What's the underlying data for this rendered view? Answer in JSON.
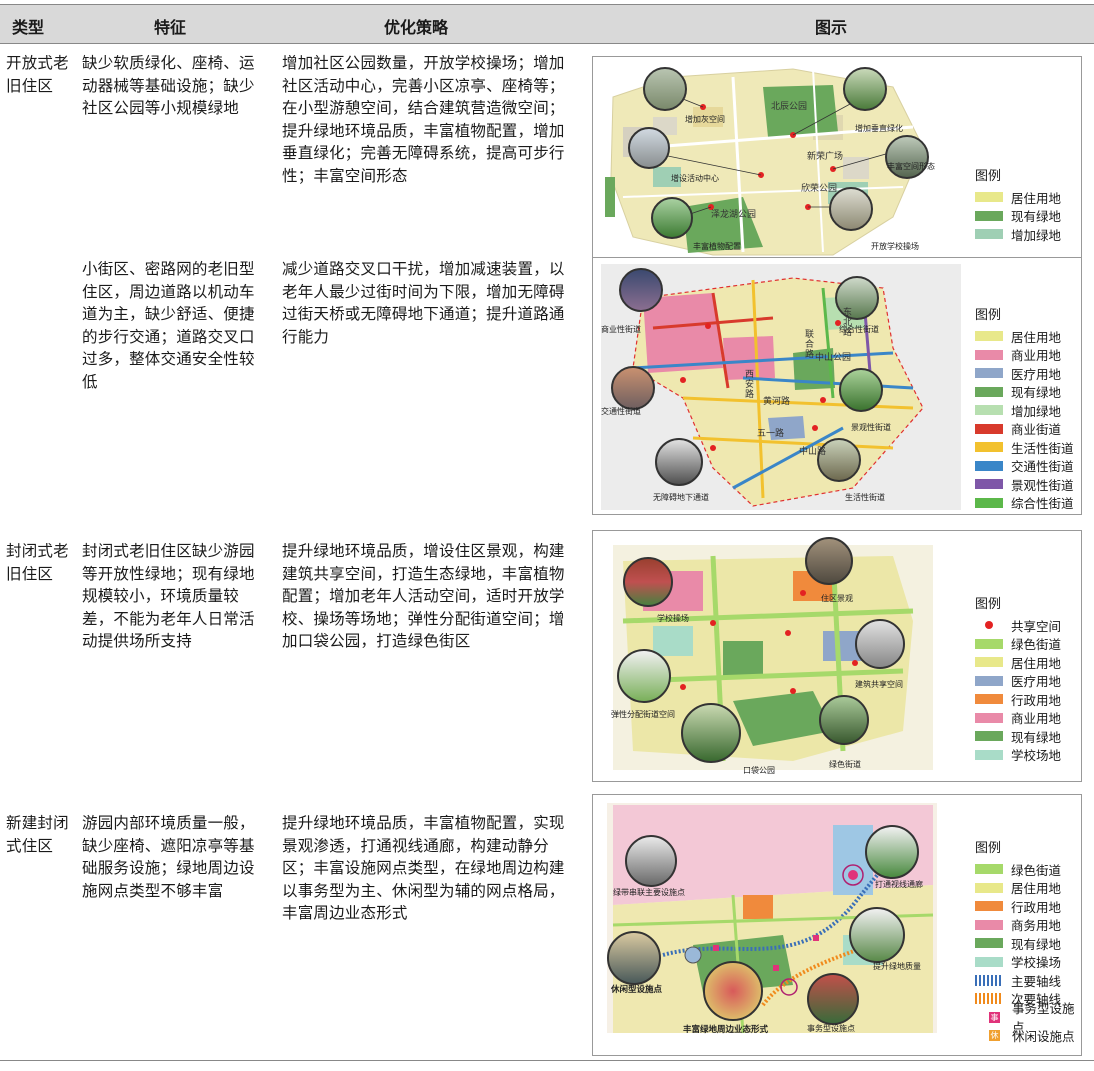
{
  "header": {
    "type": "类型",
    "feature": "特征",
    "strategy": "优化策略",
    "figure": "图示"
  },
  "rows": [
    {
      "type": "开放式老旧住区",
      "feature": "缺少软质绿化、座椅、运动器械等基础设施；缺少社区公园等小规模绿地",
      "strategy": "增加社区公园数量，开放学校操场；增加社区活动中心，完善小区凉亭、座椅等；在小型游憩空间，结合建筑营造微空间；提升绿地环境品质，丰富植物配置，增加垂直绿化；完善无障碍系统，提高可步行性；丰富空间形态",
      "figure": {
        "places": [
          "北辰公园",
          "新荣广场",
          "欣荣公园",
          "泽龙湖公园"
        ],
        "callouts": [
          "增加灰空间",
          "增加垂直绿化",
          "增设活动中心",
          "丰富空间形态",
          "丰富植物配置",
          "开放学校操场"
        ],
        "legend_title": "图例",
        "legend": [
          {
            "label": "居住用地",
            "color": "#e8e88a"
          },
          {
            "label": "现有绿地",
            "color": "#6aa85c"
          },
          {
            "label": "增加绿地",
            "color": "#9fcfb4"
          }
        ]
      }
    },
    {
      "type": "",
      "feature": "小街区、密路网的老旧型住区，周边道路以机动车道为主，缺少舒适、便捷的步行交通；道路交叉口过多，整体交通安全性较低",
      "strategy": "减少道路交叉口干扰，增加减速装置，以老年人最少过街时间为下限，增加无障碍过街天桥或无障碍地下通道；提升道路通行能力",
      "figure": {
        "places": [
          "联合路",
          "东北路",
          "中山公园",
          "黄河路",
          "西安路",
          "五一路",
          "中山路"
        ],
        "callouts": [
          "商业性街道",
          "综合性街道",
          "交通性街道",
          "景观性街道",
          "无障碍地下通道",
          "生活性街道"
        ],
        "legend_title": "图例",
        "legend": [
          {
            "label": "居住用地",
            "color": "#e8e88a"
          },
          {
            "label": "商业用地",
            "color": "#e98aa8"
          },
          {
            "label": "医疗用地",
            "color": "#8fa6c9"
          },
          {
            "label": "现有绿地",
            "color": "#6aa85c"
          },
          {
            "label": "增加绿地",
            "color": "#b7dfb0"
          },
          {
            "label": "商业街道",
            "color": "#d83a2c"
          },
          {
            "label": "生活性街道",
            "color": "#f2c12e"
          },
          {
            "label": "交通性街道",
            "color": "#3a86c8"
          },
          {
            "label": "景观性街道",
            "color": "#7e57a8"
          },
          {
            "label": "综合性街道",
            "color": "#5cb84a"
          }
        ]
      }
    },
    {
      "type": "封闭式老旧住区",
      "feature": "封闭式老旧住区缺少游园等开放性绿地；现有绿地规模较小，环境质量较差，不能为老年人日常活动提供场所支持",
      "strategy": "提升绿地环境品质，增设住区景观，构建建筑共享空间，打造生态绿地，丰富植物配置；增加老年人活动空间，适时开放学校、操场等场地；弹性分配街道空间；增加口袋公园，打造绿色街区",
      "figure": {
        "callouts": [
          "学校操场",
          "住区景观",
          "建筑共享空间",
          "弹性分配街道空间",
          "口袋公园",
          "绿色街道"
        ],
        "legend_title": "图例",
        "legend": [
          {
            "label": "共享空间",
            "kind": "dot"
          },
          {
            "label": "绿色街道",
            "color": "#a6d96a"
          },
          {
            "label": "居住用地",
            "color": "#e8e88a"
          },
          {
            "label": "医疗用地",
            "color": "#8fa6c9"
          },
          {
            "label": "行政用地",
            "color": "#f08a3c"
          },
          {
            "label": "商业用地",
            "color": "#e98aa8"
          },
          {
            "label": "现有绿地",
            "color": "#6aa85c"
          },
          {
            "label": "学校场地",
            "color": "#a9dcc8"
          }
        ]
      }
    },
    {
      "type": "新建封闭式住区",
      "feature": "游园内部环境质量一般，缺少座椅、遮阳凉亭等基础服务设施；绿地周边设施网点类型不够丰富",
      "strategy": "提升绿地环境品质，丰富植物配置，实现景观渗透，打通视线通廊，构建动静分区；丰富设施网点类型，在绿地周边构建以事务型为主、休闲型为辅的网点格局，丰富周边业态形式",
      "figure": {
        "callouts": [
          "绿带串联主要设施点",
          "打通视线通廊",
          "休闲型设施点",
          "提升绿地质量",
          "丰富绿地周边业态形式",
          "事务型设施点"
        ],
        "legend_title": "图例",
        "legend": [
          {
            "label": "绿色街道",
            "color": "#a6d96a"
          },
          {
            "label": "居住用地",
            "color": "#e8e88a"
          },
          {
            "label": "行政用地",
            "color": "#f08a3c"
          },
          {
            "label": "商务用地",
            "color": "#e98aa8"
          },
          {
            "label": "现有绿地",
            "color": "#6aa85c"
          },
          {
            "label": "学校操场",
            "color": "#a9dcc8"
          },
          {
            "label": "主要轴线",
            "kind": "bars",
            "color": "#3a6fb8"
          },
          {
            "label": "次要轴线",
            "kind": "bars",
            "color": "#f08a1c"
          },
          {
            "label": "事务型设施点",
            "kind": "icon",
            "color": "#e0337a",
            "glyph": "事"
          },
          {
            "label": "休闲设施点",
            "kind": "icon",
            "color": "#f0a030",
            "glyph": "休"
          }
        ]
      }
    }
  ]
}
